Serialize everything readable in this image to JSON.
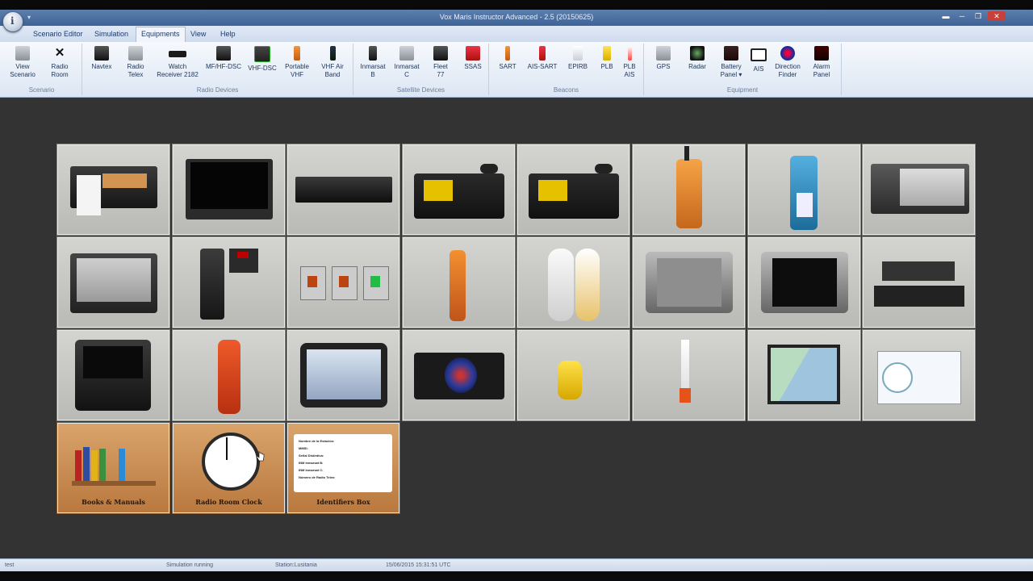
{
  "window": {
    "title": "Vox Maris Instructor Advanced - 2.5 (20150625)"
  },
  "menu": [
    "Scenario Editor",
    "Simulation",
    "Equipments",
    "View",
    "Help"
  ],
  "ribbon": {
    "groups": [
      {
        "title": "Scenario",
        "buttons": [
          {
            "label1": "View",
            "label2": "Scenario",
            "icon": "view-scenario-icon"
          },
          {
            "label1": "Radio",
            "label2": "Room",
            "icon": "radio-room-icon"
          }
        ]
      },
      {
        "title": "Radio Devices",
        "buttons": [
          {
            "label1": "Navtex",
            "label2": "",
            "icon": "navtex-icon"
          },
          {
            "label1": "Radio",
            "label2": "Telex",
            "icon": "radio-telex-icon"
          },
          {
            "label1": "Watch",
            "label2": "Receiver 2182",
            "icon": "watch-receiver-icon"
          },
          {
            "label1": "MF/HF-DSC",
            "label2": "",
            "icon": "mf-hf-dsc-icon"
          },
          {
            "label1": "VHF-DSC",
            "label2": "",
            "icon": "vhf-dsc-icon"
          },
          {
            "label1": "Portable",
            "label2": "VHF",
            "icon": "portable-vhf-icon"
          },
          {
            "label1": "VHF Air",
            "label2": "Band",
            "icon": "vhf-air-band-icon"
          }
        ]
      },
      {
        "title": "Satellite Devices",
        "buttons": [
          {
            "label1": "Inmarsat",
            "label2": "B",
            "icon": "inmarsat-b-icon"
          },
          {
            "label1": "Inmarsat",
            "label2": "C",
            "icon": "inmarsat-c-icon"
          },
          {
            "label1": "Fleet",
            "label2": "77",
            "icon": "fleet-77-icon"
          },
          {
            "label1": "SSAS",
            "label2": "",
            "icon": "ssas-icon"
          }
        ]
      },
      {
        "title": "Beacons",
        "buttons": [
          {
            "label1": "SART",
            "label2": "",
            "icon": "sart-icon"
          },
          {
            "label1": "AIS-SART",
            "label2": "",
            "icon": "ais-sart-icon"
          },
          {
            "label1": "EPIRB",
            "label2": "",
            "icon": "epirb-icon"
          },
          {
            "label1": "PLB",
            "label2": "",
            "icon": "plb-icon"
          },
          {
            "label1": "PLB",
            "label2": "AIS",
            "icon": "plb-ais-icon"
          }
        ]
      },
      {
        "title": "Equipment",
        "buttons": [
          {
            "label1": "GPS",
            "label2": "",
            "icon": "gps-icon"
          },
          {
            "label1": "Radar",
            "label2": "",
            "icon": "radar-icon"
          },
          {
            "label1": "Battery",
            "label2": "Panel ▾",
            "icon": "battery-panel-icon"
          },
          {
            "label1": "AIS",
            "label2": "",
            "icon": "ais-icon"
          },
          {
            "label1": "Direction",
            "label2": "Finder",
            "icon": "direction-finder-icon"
          },
          {
            "label1": "Alarm",
            "label2": "Panel",
            "icon": "alarm-panel-icon"
          }
        ]
      }
    ]
  },
  "bottom_tiles": [
    "Books & Manuals",
    "Radio Room Clock",
    "Identifiers Box"
  ],
  "identifiers_card": [
    "Nombre de la Estación:",
    "MMSI:",
    "Señal Distintiva:",
    "INM Inmarsat B:",
    "INM Inmarsat C:",
    "Número de Radio Telex:"
  ],
  "status": {
    "left": "test",
    "sim": "Simulation running",
    "station": "Station:Lusitania",
    "time": "15/06/2015 15:31:51 UTC"
  }
}
